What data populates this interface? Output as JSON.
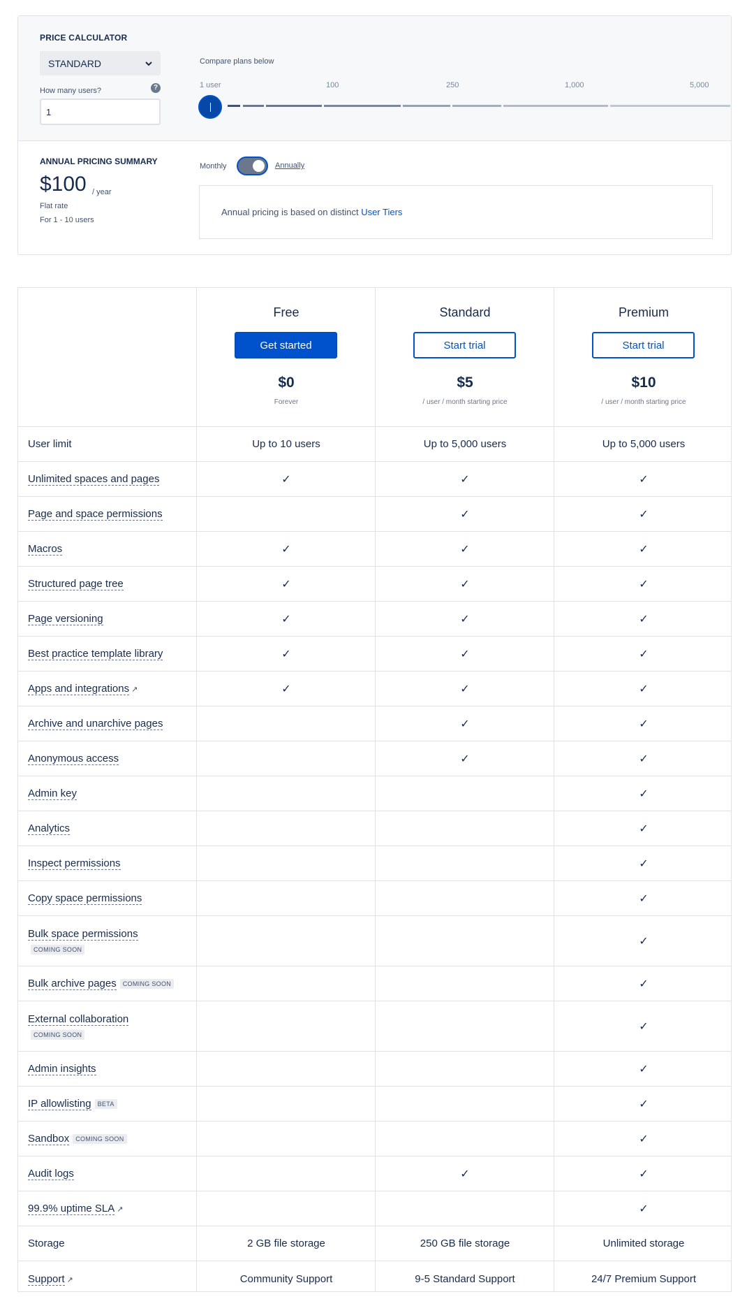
{
  "calculator": {
    "title": "PRICE CALCULATOR",
    "plan_select": "STANDARD",
    "users_label": "How many users?",
    "users_value": "1",
    "compare_label": "Compare plans below",
    "ticks": [
      "1 user",
      "100",
      "250",
      "1,000",
      "5,000"
    ],
    "slider_value_users": 1
  },
  "summary": {
    "title": "ANNUAL PRICING SUMMARY",
    "price": "$100",
    "price_unit": "/ year",
    "flat_rate": "Flat rate",
    "for_users": "For 1 - 10 users",
    "monthly_label": "Monthly",
    "annually_label": "Annually",
    "billing_toggle": "annually",
    "info_text": "Annual pricing is based on distinct",
    "info_link": "User Tiers"
  },
  "plans": [
    {
      "name": "Free",
      "button": "Get started",
      "price": "$0",
      "sub": "Forever"
    },
    {
      "name": "Standard",
      "button": "Start trial",
      "price": "$5",
      "sub": "/ user / month starting price"
    },
    {
      "name": "Premium",
      "button": "Start trial",
      "price": "$10",
      "sub": "/ user / month starting price"
    }
  ],
  "rows": [
    {
      "label": "User limit",
      "plain": true,
      "values": [
        "Up to 10 users",
        "Up to 5,000 users",
        "Up to 5,000 users"
      ]
    },
    {
      "label": "Unlimited spaces and pages",
      "values": [
        "✓",
        "✓",
        "✓"
      ]
    },
    {
      "label": "Page and space permissions",
      "values": [
        "",
        "✓",
        "✓"
      ]
    },
    {
      "label": "Macros",
      "values": [
        "✓",
        "✓",
        "✓"
      ]
    },
    {
      "label": "Structured page tree",
      "values": [
        "✓",
        "✓",
        "✓"
      ]
    },
    {
      "label": "Page versioning",
      "values": [
        "✓",
        "✓",
        "✓"
      ]
    },
    {
      "label": "Best practice template library",
      "values": [
        "✓",
        "✓",
        "✓"
      ]
    },
    {
      "label": "Apps and integrations",
      "external": true,
      "values": [
        "✓",
        "✓",
        "✓"
      ]
    },
    {
      "label": "Archive and unarchive pages",
      "values": [
        "",
        "✓",
        "✓"
      ]
    },
    {
      "label": "Anonymous access",
      "values": [
        "",
        "✓",
        "✓"
      ]
    },
    {
      "label": "Admin key",
      "values": [
        "",
        "",
        "✓"
      ]
    },
    {
      "label": "Analytics",
      "values": [
        "",
        "",
        "✓"
      ]
    },
    {
      "label": "Inspect permissions",
      "values": [
        "",
        "",
        "✓"
      ]
    },
    {
      "label": "Copy space permissions",
      "values": [
        "",
        "",
        "✓"
      ]
    },
    {
      "label": "Bulk space permissions",
      "tag": "COMING SOON",
      "tag_block": true,
      "values": [
        "",
        "",
        "✓"
      ]
    },
    {
      "label": "Bulk archive pages",
      "tag": "COMING SOON",
      "values": [
        "",
        "",
        "✓"
      ]
    },
    {
      "label": "External collaboration",
      "tag": "COMING SOON",
      "tag_block": true,
      "values": [
        "",
        "",
        "✓"
      ]
    },
    {
      "label": "Admin insights",
      "values": [
        "",
        "",
        "✓"
      ]
    },
    {
      "label": "IP allowlisting",
      "tag": "BETA",
      "values": [
        "",
        "",
        "✓"
      ]
    },
    {
      "label": "Sandbox",
      "tag": "COMING SOON",
      "values": [
        "",
        "",
        "✓"
      ]
    },
    {
      "label": "Audit logs",
      "values": [
        "",
        "✓",
        "✓"
      ]
    },
    {
      "label": "99.9% uptime SLA",
      "external": true,
      "values": [
        "",
        "",
        "✓"
      ]
    },
    {
      "label": "Storage",
      "plain": true,
      "values": [
        "2 GB file storage",
        "250 GB file storage",
        "Unlimited storage"
      ]
    },
    {
      "label": "Support",
      "external": true,
      "values": [
        "Community Support",
        "9-5 Standard Support",
        "24/7 Premium Support"
      ]
    }
  ],
  "colors": {
    "accent": "#0052cc",
    "accent_dark": "#0747a6",
    "text": "#172b4d",
    "border": "#dfe1e6",
    "panel_bg": "#f7f8f9"
  }
}
